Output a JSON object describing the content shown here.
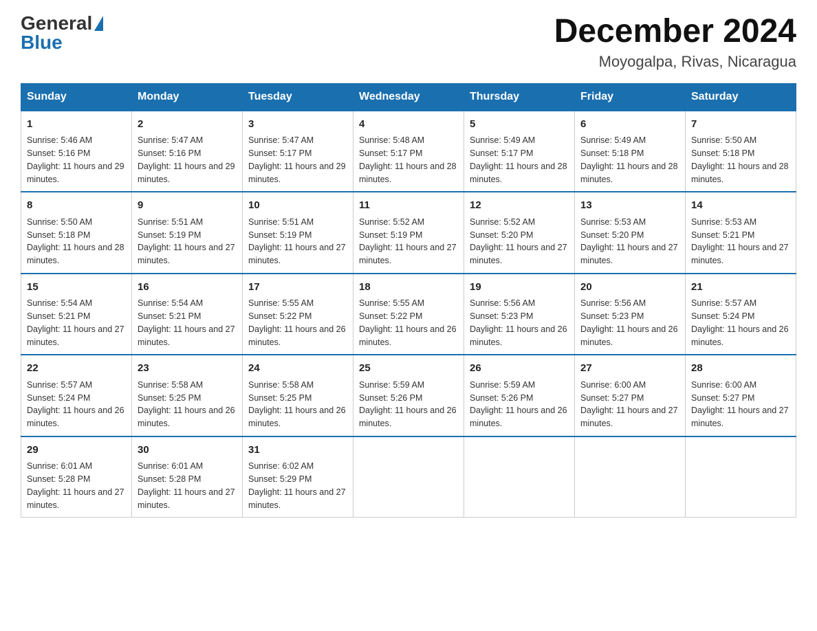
{
  "header": {
    "logo": {
      "general": "General",
      "triangle": "▶",
      "blue": "Blue"
    },
    "title": "December 2024",
    "location": "Moyogalpa, Rivas, Nicaragua"
  },
  "calendar": {
    "days_of_week": [
      "Sunday",
      "Monday",
      "Tuesday",
      "Wednesday",
      "Thursday",
      "Friday",
      "Saturday"
    ],
    "weeks": [
      [
        {
          "day": "1",
          "sunrise": "Sunrise: 5:46 AM",
          "sunset": "Sunset: 5:16 PM",
          "daylight": "Daylight: 11 hours and 29 minutes."
        },
        {
          "day": "2",
          "sunrise": "Sunrise: 5:47 AM",
          "sunset": "Sunset: 5:16 PM",
          "daylight": "Daylight: 11 hours and 29 minutes."
        },
        {
          "day": "3",
          "sunrise": "Sunrise: 5:47 AM",
          "sunset": "Sunset: 5:17 PM",
          "daylight": "Daylight: 11 hours and 29 minutes."
        },
        {
          "day": "4",
          "sunrise": "Sunrise: 5:48 AM",
          "sunset": "Sunset: 5:17 PM",
          "daylight": "Daylight: 11 hours and 28 minutes."
        },
        {
          "day": "5",
          "sunrise": "Sunrise: 5:49 AM",
          "sunset": "Sunset: 5:17 PM",
          "daylight": "Daylight: 11 hours and 28 minutes."
        },
        {
          "day": "6",
          "sunrise": "Sunrise: 5:49 AM",
          "sunset": "Sunset: 5:18 PM",
          "daylight": "Daylight: 11 hours and 28 minutes."
        },
        {
          "day": "7",
          "sunrise": "Sunrise: 5:50 AM",
          "sunset": "Sunset: 5:18 PM",
          "daylight": "Daylight: 11 hours and 28 minutes."
        }
      ],
      [
        {
          "day": "8",
          "sunrise": "Sunrise: 5:50 AM",
          "sunset": "Sunset: 5:18 PM",
          "daylight": "Daylight: 11 hours and 28 minutes."
        },
        {
          "day": "9",
          "sunrise": "Sunrise: 5:51 AM",
          "sunset": "Sunset: 5:19 PM",
          "daylight": "Daylight: 11 hours and 27 minutes."
        },
        {
          "day": "10",
          "sunrise": "Sunrise: 5:51 AM",
          "sunset": "Sunset: 5:19 PM",
          "daylight": "Daylight: 11 hours and 27 minutes."
        },
        {
          "day": "11",
          "sunrise": "Sunrise: 5:52 AM",
          "sunset": "Sunset: 5:19 PM",
          "daylight": "Daylight: 11 hours and 27 minutes."
        },
        {
          "day": "12",
          "sunrise": "Sunrise: 5:52 AM",
          "sunset": "Sunset: 5:20 PM",
          "daylight": "Daylight: 11 hours and 27 minutes."
        },
        {
          "day": "13",
          "sunrise": "Sunrise: 5:53 AM",
          "sunset": "Sunset: 5:20 PM",
          "daylight": "Daylight: 11 hours and 27 minutes."
        },
        {
          "day": "14",
          "sunrise": "Sunrise: 5:53 AM",
          "sunset": "Sunset: 5:21 PM",
          "daylight": "Daylight: 11 hours and 27 minutes."
        }
      ],
      [
        {
          "day": "15",
          "sunrise": "Sunrise: 5:54 AM",
          "sunset": "Sunset: 5:21 PM",
          "daylight": "Daylight: 11 hours and 27 minutes."
        },
        {
          "day": "16",
          "sunrise": "Sunrise: 5:54 AM",
          "sunset": "Sunset: 5:21 PM",
          "daylight": "Daylight: 11 hours and 27 minutes."
        },
        {
          "day": "17",
          "sunrise": "Sunrise: 5:55 AM",
          "sunset": "Sunset: 5:22 PM",
          "daylight": "Daylight: 11 hours and 26 minutes."
        },
        {
          "day": "18",
          "sunrise": "Sunrise: 5:55 AM",
          "sunset": "Sunset: 5:22 PM",
          "daylight": "Daylight: 11 hours and 26 minutes."
        },
        {
          "day": "19",
          "sunrise": "Sunrise: 5:56 AM",
          "sunset": "Sunset: 5:23 PM",
          "daylight": "Daylight: 11 hours and 26 minutes."
        },
        {
          "day": "20",
          "sunrise": "Sunrise: 5:56 AM",
          "sunset": "Sunset: 5:23 PM",
          "daylight": "Daylight: 11 hours and 26 minutes."
        },
        {
          "day": "21",
          "sunrise": "Sunrise: 5:57 AM",
          "sunset": "Sunset: 5:24 PM",
          "daylight": "Daylight: 11 hours and 26 minutes."
        }
      ],
      [
        {
          "day": "22",
          "sunrise": "Sunrise: 5:57 AM",
          "sunset": "Sunset: 5:24 PM",
          "daylight": "Daylight: 11 hours and 26 minutes."
        },
        {
          "day": "23",
          "sunrise": "Sunrise: 5:58 AM",
          "sunset": "Sunset: 5:25 PM",
          "daylight": "Daylight: 11 hours and 26 minutes."
        },
        {
          "day": "24",
          "sunrise": "Sunrise: 5:58 AM",
          "sunset": "Sunset: 5:25 PM",
          "daylight": "Daylight: 11 hours and 26 minutes."
        },
        {
          "day": "25",
          "sunrise": "Sunrise: 5:59 AM",
          "sunset": "Sunset: 5:26 PM",
          "daylight": "Daylight: 11 hours and 26 minutes."
        },
        {
          "day": "26",
          "sunrise": "Sunrise: 5:59 AM",
          "sunset": "Sunset: 5:26 PM",
          "daylight": "Daylight: 11 hours and 26 minutes."
        },
        {
          "day": "27",
          "sunrise": "Sunrise: 6:00 AM",
          "sunset": "Sunset: 5:27 PM",
          "daylight": "Daylight: 11 hours and 27 minutes."
        },
        {
          "day": "28",
          "sunrise": "Sunrise: 6:00 AM",
          "sunset": "Sunset: 5:27 PM",
          "daylight": "Daylight: 11 hours and 27 minutes."
        }
      ],
      [
        {
          "day": "29",
          "sunrise": "Sunrise: 6:01 AM",
          "sunset": "Sunset: 5:28 PM",
          "daylight": "Daylight: 11 hours and 27 minutes."
        },
        {
          "day": "30",
          "sunrise": "Sunrise: 6:01 AM",
          "sunset": "Sunset: 5:28 PM",
          "daylight": "Daylight: 11 hours and 27 minutes."
        },
        {
          "day": "31",
          "sunrise": "Sunrise: 6:02 AM",
          "sunset": "Sunset: 5:29 PM",
          "daylight": "Daylight: 11 hours and 27 minutes."
        },
        null,
        null,
        null,
        null
      ]
    ]
  }
}
